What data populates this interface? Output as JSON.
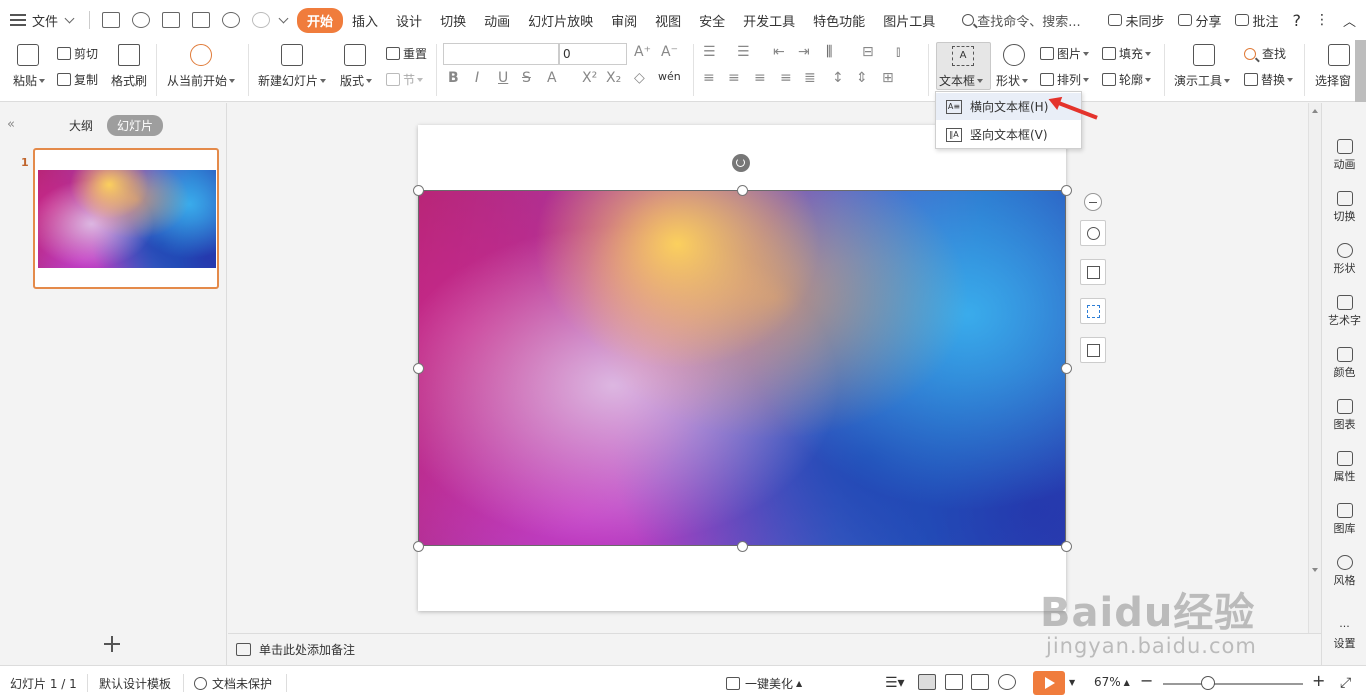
{
  "menubar": {
    "file_label": "文件",
    "tabs": [
      "开始",
      "插入",
      "设计",
      "切换",
      "动画",
      "幻灯片放映",
      "审阅",
      "视图",
      "安全",
      "开发工具",
      "特色功能",
      "图片工具"
    ],
    "active_tab": "开始",
    "search_label": "查找命令、搜索...",
    "sync_label": "未同步",
    "share_label": "分享",
    "comment_label": "批注",
    "help_label": "?",
    "more_label": "⋮"
  },
  "ribbon": {
    "paste": "粘贴",
    "cut": "剪切",
    "copy": "复制",
    "format_painter": "格式刷",
    "from_current": "从当前开始",
    "new_slide": "新建幻灯片",
    "layout": "版式",
    "reset": "重置",
    "section": "节",
    "font_size": "0",
    "textbox": "文本框",
    "shape": "形状",
    "picture": "图片",
    "fill": "填充",
    "arrange": "排列",
    "outline": "轮廓",
    "presentation_tools": "演示工具",
    "find": "查找",
    "replace": "替换",
    "select_pane": "选择窗"
  },
  "textbox_menu": {
    "horizontal": "横向文本框(H)",
    "vertical": "竖向文本框(V)"
  },
  "left_panel": {
    "outline_tab": "大纲",
    "slides_tab": "幻灯片",
    "slide_number": "1"
  },
  "notes": {
    "placeholder": "单击此处添加备注"
  },
  "right_sidebar": [
    "动画",
    "切换",
    "形状",
    "艺术字",
    "颜色",
    "图表",
    "属性",
    "图库",
    "风格",
    "设置"
  ],
  "status": {
    "slide_count": "幻灯片 1 / 1",
    "template": "默认设计模板",
    "protection": "文档未保护",
    "beautify": "一键美化",
    "zoom": "67%"
  },
  "watermark": {
    "brand": "Baidu经验",
    "url": "jingyan.baidu.com"
  },
  "colors": {
    "accent": "#f07c3c",
    "arrow": "#e4332c",
    "thumb_border": "#e48a4a"
  }
}
